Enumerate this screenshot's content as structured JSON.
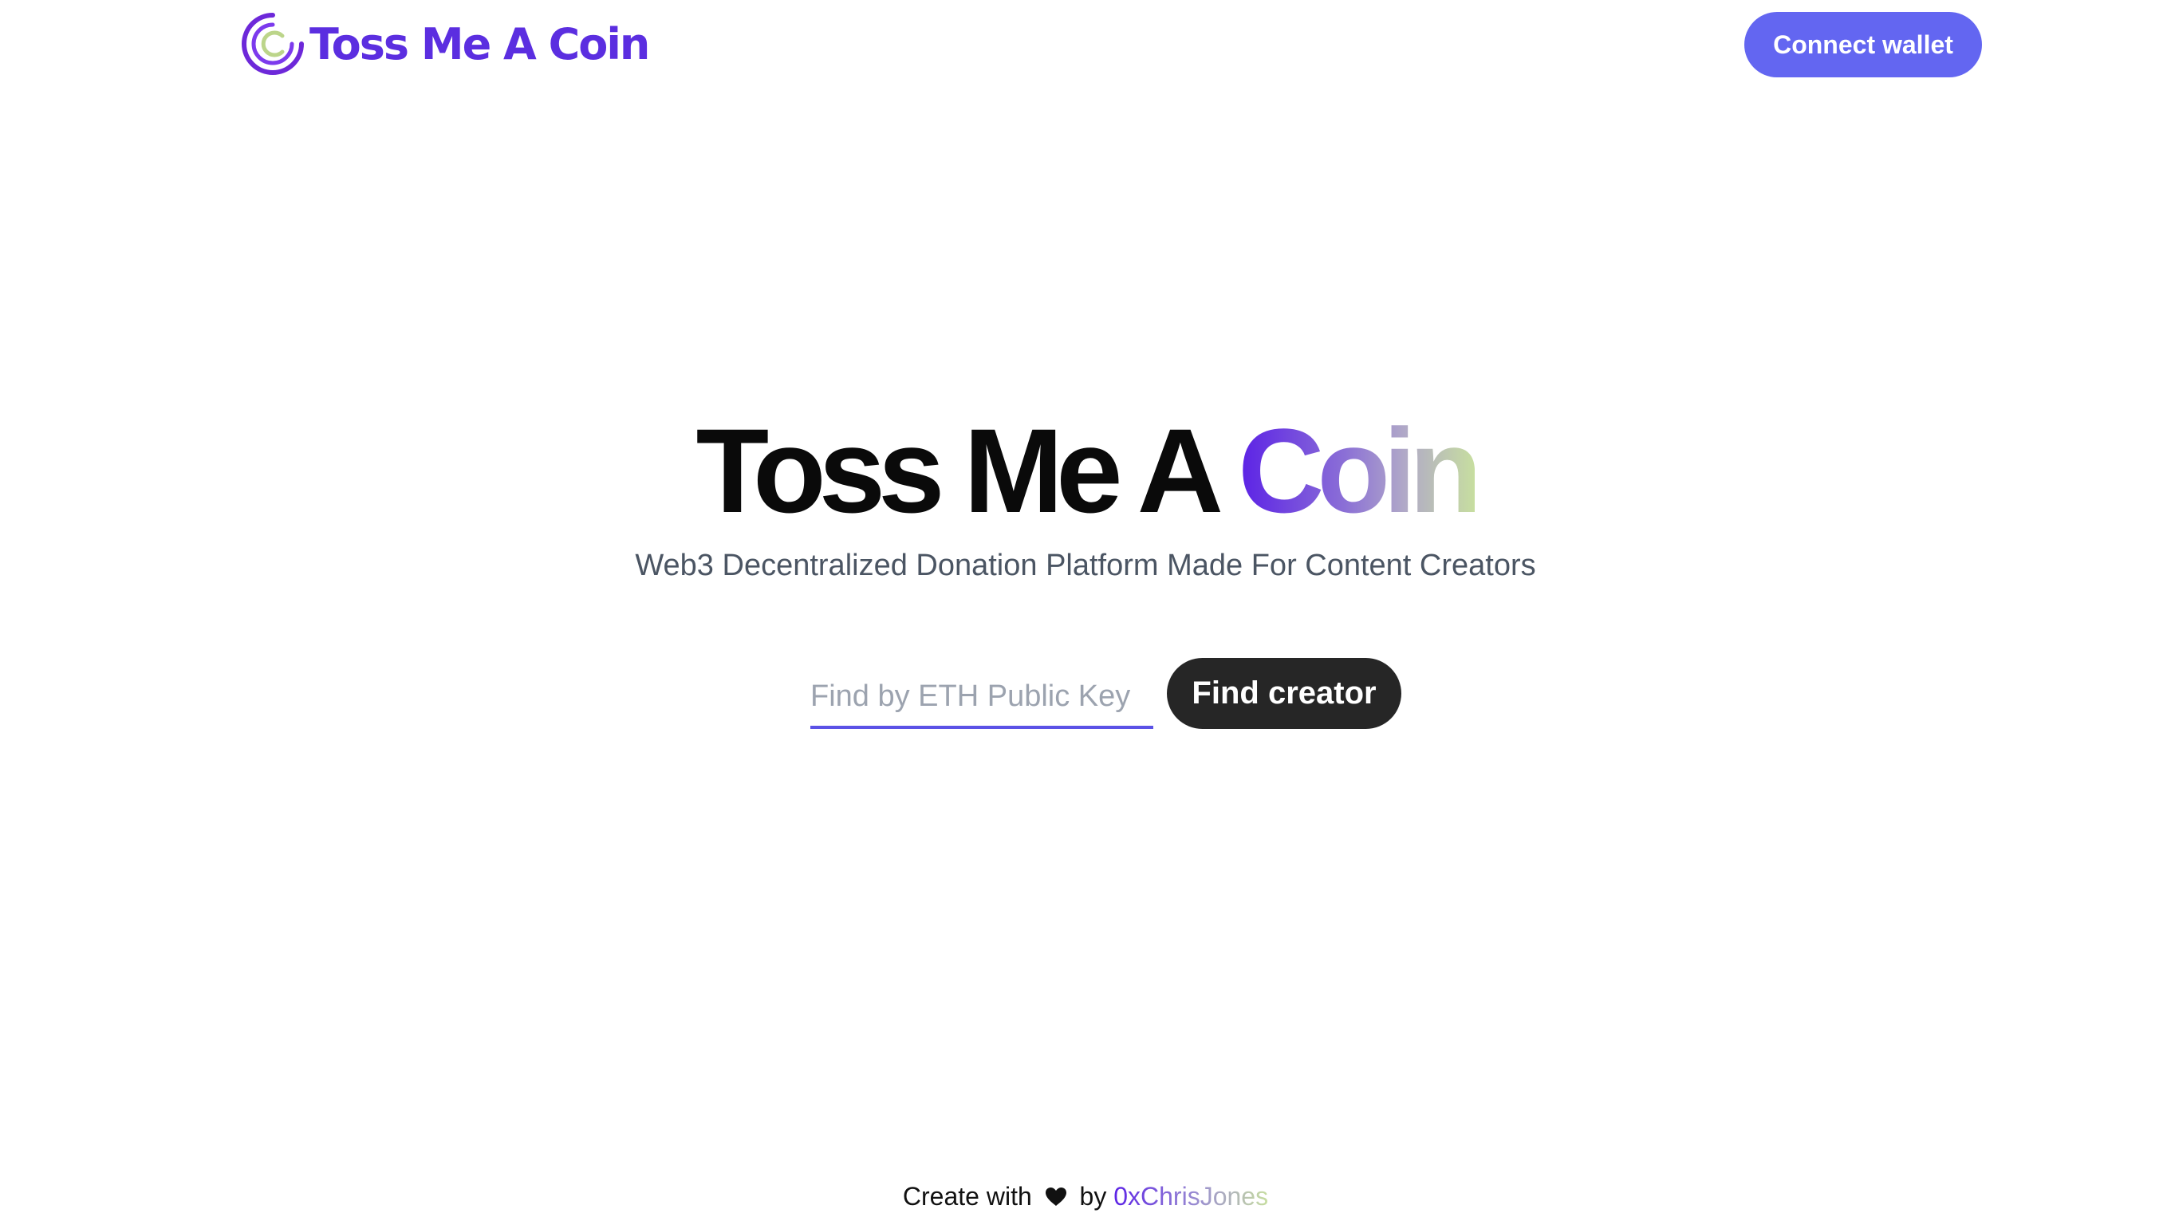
{
  "header": {
    "logo": {
      "icon": "coin-logo-icon",
      "text": "Toss Me A Coin",
      "color": "#5b2ee0"
    },
    "connect_wallet_label": "Connect wallet",
    "connect_wallet_color": "#6366f1"
  },
  "hero": {
    "title_main": "Toss Me A ",
    "title_highlight": "Coin",
    "highlight_gradient": [
      "#5b21e6",
      "#8b6fd6",
      "#b0a8c8",
      "#c7dea0"
    ],
    "subtitle": "Web3 Decentralized Donation Platform Made For Content Creators"
  },
  "search": {
    "value": "",
    "placeholder": "Find by ETH Public Key",
    "underline_color": "#5b52e6",
    "button_label": "Find creator",
    "button_color": "#262626"
  },
  "footer": {
    "prefix": "Create with",
    "heart_icon": "heart-icon",
    "middle": "by",
    "author": "0xChrisJones"
  }
}
